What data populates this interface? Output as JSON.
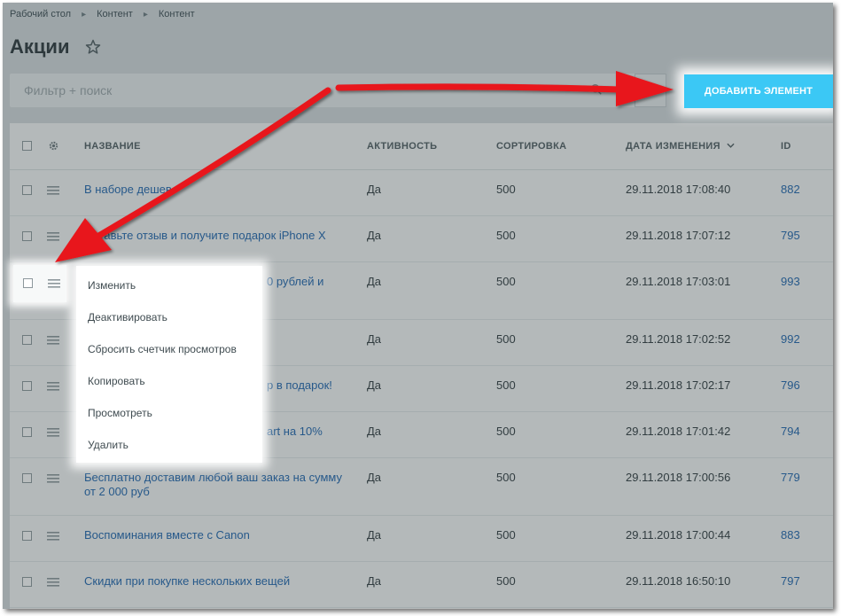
{
  "breadcrumb": [
    "Рабочий стол",
    "Контент",
    "Контент"
  ],
  "page_title": "Акции",
  "filter": {
    "placeholder": "Фильтр + поиск"
  },
  "add_button": "ДОБАВИТЬ ЭЛЕМЕНТ",
  "columns": {
    "name": "НАЗВАНИЕ",
    "activity": "АКТИВНОСТЬ",
    "sort": "СОРТИРОВКА",
    "date": "ДАТА ИЗМЕНЕНИЯ",
    "id": "ID"
  },
  "rows": [
    {
      "name": "В наборе дешев",
      "active": "Да",
      "sort": "500",
      "date": "29.11.2018 17:08:40",
      "id": "882"
    },
    {
      "name": "Оставьте отзыв и получите подарок iPhone X",
      "active": "Да",
      "sort": "500",
      "date": "29.11.2018 17:07:12",
      "id": "795"
    },
    {
      "name": "0 рублей и",
      "active": "Да",
      "sort": "500",
      "date": "29.11.2018 17:03:01",
      "id": "993"
    },
    {
      "name": "",
      "active": "Да",
      "sort": "500",
      "date": "29.11.2018 17:02:52",
      "id": "992"
    },
    {
      "name": "р в подарок!",
      "active": "Да",
      "sort": "500",
      "date": "29.11.2018 17:02:17",
      "id": "796"
    },
    {
      "name": "art на 10%",
      "active": "Да",
      "sort": "500",
      "date": "29.11.2018 17:01:42",
      "id": "794"
    },
    {
      "name": "Бесплатно доставим любой ваш заказ на сумму от 2 000 руб",
      "active": "Да",
      "sort": "500",
      "date": "29.11.2018 17:00:56",
      "id": "779"
    },
    {
      "name": "Воспоминания вместе с Canon",
      "active": "Да",
      "sort": "500",
      "date": "29.11.2018 17:00:44",
      "id": "883"
    },
    {
      "name": "Скидки при покупке нескольких вещей",
      "active": "Да",
      "sort": "500",
      "date": "29.11.2018 16:50:10",
      "id": "797"
    }
  ],
  "context_menu": [
    "Изменить",
    "Деактивировать",
    "Сбросить счетчик просмотров",
    "Копировать",
    "Просмотреть",
    "Удалить"
  ],
  "colors": {
    "accent": "#3bc8f5",
    "link": "#2066b0",
    "arrow": "#e8141a"
  }
}
